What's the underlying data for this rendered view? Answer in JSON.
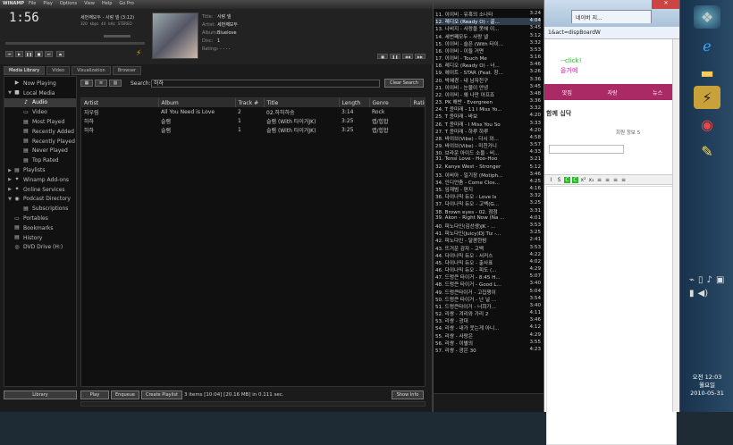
{
  "winamp": {
    "brand": "WINAMP",
    "menu": [
      "File",
      "Play",
      "Options",
      "View",
      "Help",
      "Go Pro"
    ],
    "time": "1:56",
    "scroll_title": "세번째모두 - 사랑 넬 (3:12)",
    "bitrate": [
      "320",
      "kbps",
      "44",
      "kHz",
      "STEREO"
    ],
    "meta": {
      "title_k": "Title:",
      "title_v": "사랑 넬",
      "artist_k": "Artist:",
      "artist_v": "세번째모두",
      "album_k": "Album:",
      "album_v": "Bluelove",
      "disc_k": "Disc:",
      "disc_v": "1",
      "rating_k": "Rating:",
      "rating_v": "· · · · ·"
    }
  },
  "tabs": [
    "Media Library",
    "Video",
    "Visualization",
    "Browser"
  ],
  "tree": [
    {
      "label": "Now Playing",
      "arrow": "",
      "icon": "▶",
      "level": 0
    },
    {
      "label": "Local Media",
      "arrow": "▼",
      "icon": "■",
      "level": 0
    },
    {
      "label": "Audio",
      "arrow": "",
      "icon": "♪",
      "level": 1,
      "selected": true
    },
    {
      "label": "Video",
      "arrow": "",
      "icon": "▭",
      "level": 1
    },
    {
      "label": "Most Played",
      "arrow": "",
      "icon": "▤",
      "level": 1
    },
    {
      "label": "Recently Added",
      "arrow": "",
      "icon": "▤",
      "level": 1
    },
    {
      "label": "Recently Played",
      "arrow": "",
      "icon": "▤",
      "level": 1
    },
    {
      "label": "Never Played",
      "arrow": "",
      "icon": "▤",
      "level": 1
    },
    {
      "label": "Top Rated",
      "arrow": "",
      "icon": "▤",
      "level": 1
    },
    {
      "label": "Playlists",
      "arrow": "▶",
      "icon": "▤",
      "level": 0
    },
    {
      "label": "Winamp Add-ons",
      "arrow": "▶",
      "icon": "✦",
      "level": 0
    },
    {
      "label": "Online Services",
      "arrow": "▶",
      "icon": "✦",
      "level": 0
    },
    {
      "label": "Podcast Directory",
      "arrow": "▼",
      "icon": "◉",
      "level": 0
    },
    {
      "label": "Subscriptions",
      "arrow": "",
      "icon": "▤",
      "level": 1
    },
    {
      "label": "Portables",
      "arrow": "",
      "icon": "▭",
      "level": 0
    },
    {
      "label": "Bookmarks",
      "arrow": "",
      "icon": "▤",
      "level": 0
    },
    {
      "label": "History",
      "arrow": "",
      "icon": "▤",
      "level": 0
    },
    {
      "label": "DVD Drive (H:)",
      "arrow": "",
      "icon": "◎",
      "level": 0
    }
  ],
  "search": {
    "label": "Search:",
    "value": "하하",
    "clear": "Clear Search"
  },
  "table": {
    "columns": [
      "Artist",
      "Album",
      "Track #",
      "Title",
      "Length",
      "Genre",
      "Ratin"
    ],
    "rows": [
      [
        "자우림",
        "All You Need is Love",
        "2",
        "02.하하하송",
        "3:14",
        "Rock",
        ""
      ],
      [
        "하하",
        "슬램",
        "1",
        "슬램 (With 타이거JK)",
        "3:25",
        "랩/힙합",
        ""
      ],
      [
        "하하",
        "슬램",
        "1",
        "슬램 (With 타이거JK)",
        "3:25",
        "랩/힙합",
        ""
      ]
    ]
  },
  "bottom": {
    "library": "Library",
    "play": "Play",
    "enqueue": "Enqueue",
    "create_playlist": "Create Playlist",
    "status": "3 items [10:04] [20.16 MB] in 0.111 sec.",
    "show_info": "Show Info"
  },
  "playlist": [
    [
      "11. 이이비 - 유혹의 소나타",
      "3:24"
    ],
    [
      "12. 레디오 (Ready O) - 골...",
      "4:04"
    ],
    [
      "13. 나비지 - 사랑을 못해 이...",
      "3:45"
    ],
    [
      "14. 세번째모두 - 사랑 넬",
      "3:12"
    ],
    [
      "15. 이이비 - 슬픈 (With 타이...",
      "3:32"
    ],
    [
      "16. 이이비 - 이들 거면",
      "3:53"
    ],
    [
      "17. 이이비 - Touch Me",
      "3:16"
    ],
    [
      "18. 레디오 (Ready O) - 너...",
      "3:46"
    ],
    [
      "19. 에이트 - STAR (Feat. 창...",
      "3:26"
    ],
    [
      "20. 박혜경 - 내 남자친구",
      "3:36"
    ],
    [
      "21. 이이비 - 눈물이 안녕",
      "3:45"
    ],
    [
      "22. 이이비 - 왜 나만 아프죠",
      "3:48"
    ],
    [
      "23. PK 해반 - Evergreen",
      "3:36"
    ],
    [
      "24. T 윤미래 - 11 I Miss Yo...",
      "3:32"
    ],
    [
      "25. T 윤미래 - 바보",
      "4:20"
    ],
    [
      "26. T 윤미래 - I Miss You So",
      "3:33"
    ],
    [
      "27. T 윤미래 - 하루 하루",
      "4:20"
    ],
    [
      "28. 바이브(Vibe) - 다시 와...",
      "4:58"
    ],
    [
      "29. 바이브(Vibe) - 미친거니",
      "3:57"
    ],
    [
      "30. 브라운 아이드 소울 - 비...",
      "4:33"
    ],
    [
      "31. Tensi Love - Hoo-Hoo",
      "3:21"
    ],
    [
      "32. Kanye West - Stronger",
      "5:12"
    ],
    [
      "33. 이비아 - 일기장 (Motiph...",
      "3:46"
    ],
    [
      "34. 인디언춤 - Come Clos...",
      "4:25"
    ],
    [
      "35. 임재범 - 편지",
      "4:16"
    ],
    [
      "36. 다이나믹 듀오 - Love Is",
      "3:32"
    ],
    [
      "37. 다이나믹 듀오 - 고백(G...",
      "3:25"
    ],
    [
      "38. Brown eyes - 02. 점점",
      "3:31"
    ],
    [
      "39. Akon - Right Now (Na ...",
      "4:01"
    ],
    [
      "40. 피노다인(김선생)JK - ...",
      "3:53"
    ],
    [
      "41. 피노다인(Juicy)DJ Tiz -...",
      "3:25"
    ],
    [
      "42. 피노다인 - 달콤한밤",
      "2:41"
    ],
    [
      "43. 뜨거운 감자 - 고백",
      "3:53"
    ],
    [
      "44. 다이나믹 듀오 - 서커스",
      "4:22"
    ],
    [
      "45. 다이나믹 듀오 - 출사표",
      "4:02"
    ],
    [
      "46. 다이나믹 듀오 - 피도 (...",
      "4:29"
    ],
    [
      "47. 드렁큰 타이거 - 8:45 H...",
      "5:07"
    ],
    [
      "48. 드렁큰 타이거 - Good L...",
      "3:40"
    ],
    [
      "49. 드렁큰타이거 - 고집쟁이",
      "5:04"
    ],
    [
      "50. 드렁큰 타이거 - 난 널 ...",
      "3:54"
    ],
    [
      "51. 드렁큰타이거 - 너희가...",
      "3:40"
    ],
    [
      "52. 리쌍 - 겨리와 가리 2",
      "4:11"
    ],
    [
      "53. 리쌍 - 광대",
      "3:46"
    ],
    [
      "54. 리쌍 - 내가 웃는게 아니...",
      "4:12"
    ],
    [
      "55. 리쌍 - 사랑은",
      "4:29"
    ],
    [
      "56. 리쌍 - 이별의",
      "3:55"
    ],
    [
      "57. 리쌍 - 광은 30",
      "4:23"
    ]
  ],
  "browser": {
    "tab": "네이버 지...",
    "address": "1&act=dispBoardW",
    "click_line": "--click!",
    "click_line2": "을거예",
    "nav": [
      "맛집",
      "자랑",
      "뉴스"
    ],
    "crumb": "함께 십닥",
    "user_info": "회원 정보 5",
    "editor_buttons": [
      "I",
      "S",
      "C",
      "C",
      "x²",
      "x₂",
      "≡",
      "≡",
      "≡",
      "≡"
    ]
  },
  "taskbar": {
    "time": "오전 12:03",
    "day": "월요일",
    "date": "2010-05-31"
  }
}
